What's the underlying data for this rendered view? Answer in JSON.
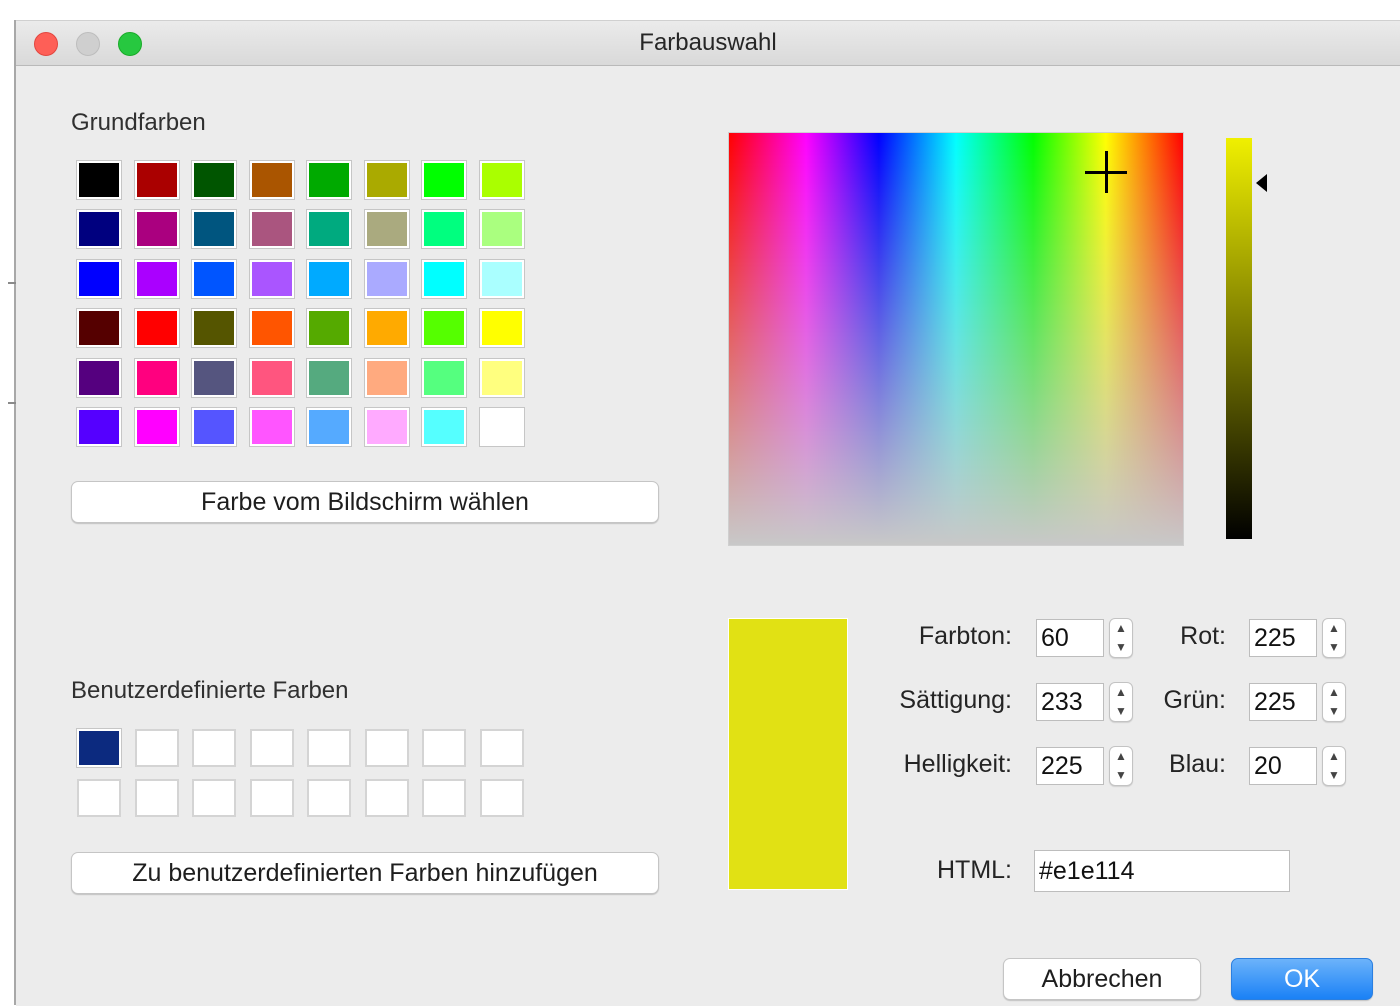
{
  "window": {
    "title": "Farbauswahl"
  },
  "basic_colors": {
    "label": "Grundfarben",
    "swatches": [
      [
        "#000000",
        "#aa0000",
        "#005500",
        "#aa5500",
        "#00aa00",
        "#aaaa00",
        "#00ff00",
        "#aaff00"
      ],
      [
        "#00007f",
        "#aa007f",
        "#00557f",
        "#aa557f",
        "#00aa7f",
        "#aaaa7f",
        "#00ff7f",
        "#aaff7f"
      ],
      [
        "#0000ff",
        "#aa00ff",
        "#0055ff",
        "#aa55ff",
        "#00aaff",
        "#aaaaff",
        "#00ffff",
        "#aaffff"
      ],
      [
        "#550000",
        "#ff0000",
        "#555500",
        "#ff5500",
        "#55aa00",
        "#ffaa00",
        "#55ff00",
        "#ffff00"
      ],
      [
        "#55007f",
        "#ff007f",
        "#55557f",
        "#ff557f",
        "#55aa7f",
        "#ffaa7f",
        "#55ff7f",
        "#ffff7f"
      ],
      [
        "#5500ff",
        "#ff00ff",
        "#5555ff",
        "#ff55ff",
        "#55aaff",
        "#ffaaff",
        "#55ffff",
        "#ffffff"
      ]
    ],
    "pick_screen_button": "Farbe vom Bildschirm wählen"
  },
  "custom_colors": {
    "label": "Benutzerdefinierte Farben",
    "swatches": [
      [
        "#0c2a7f",
        "#ffffff",
        "#ffffff",
        "#ffffff",
        "#ffffff",
        "#ffffff",
        "#ffffff",
        "#ffffff"
      ],
      [
        "#ffffff",
        "#ffffff",
        "#ffffff",
        "#ffffff",
        "#ffffff",
        "#ffffff",
        "#ffffff",
        "#ffffff"
      ]
    ],
    "add_button": "Zu benutzerdefinierten Farben hinzufügen"
  },
  "current_color": "#e1e114",
  "hsv": {
    "hue": {
      "label": "Farbton:",
      "value": "60"
    },
    "saturation": {
      "label": "Sättigung:",
      "value": "233"
    },
    "value": {
      "label": "Helligkeit:",
      "value": "225"
    }
  },
  "rgb": {
    "red": {
      "label": "Rot:",
      "value": "225"
    },
    "green": {
      "label": "Grün:",
      "value": "225"
    },
    "blue": {
      "label": "Blau:",
      "value": "20"
    }
  },
  "html": {
    "label": "HTML:",
    "value": "#e1e114"
  },
  "buttons": {
    "cancel": "Abbrechen",
    "ok": "OK"
  },
  "icons": {
    "close": "close-traffic-light-icon",
    "minimize": "minimize-traffic-light-icon",
    "zoom": "zoom-traffic-light-icon",
    "crosshair": "crosshair-icon",
    "arrow": "triangle-left-icon",
    "stepper": "up-down-chevron-icon"
  }
}
